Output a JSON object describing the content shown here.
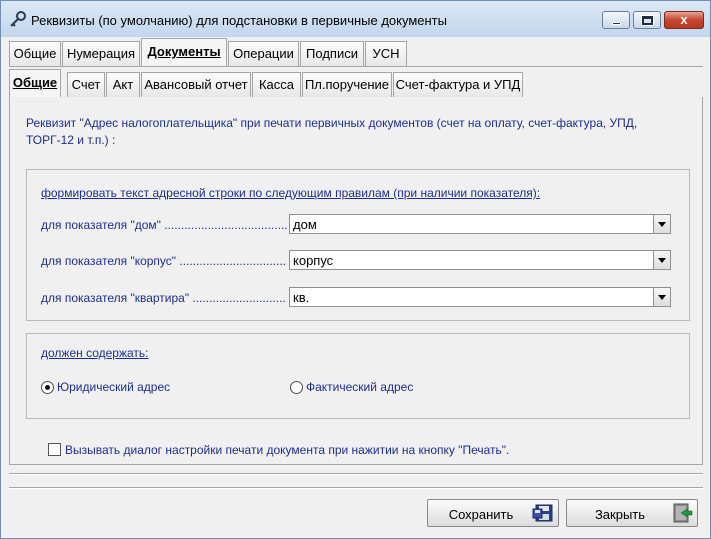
{
  "window": {
    "title": "Реквизиты (по умолчанию) для подстановки в первичные документы",
    "close_glyph": "x"
  },
  "tabs_main": [
    {
      "label": "Общие"
    },
    {
      "label": "Нумерация"
    },
    {
      "label": "Документы"
    },
    {
      "label": "Операции"
    },
    {
      "label": "Подписи"
    },
    {
      "label": "УСН"
    }
  ],
  "tabs_sub": [
    {
      "label": "Общие"
    },
    {
      "label": "Счет"
    },
    {
      "label": "Акт"
    },
    {
      "label": "Авансовый отчет"
    },
    {
      "label": "Касса"
    },
    {
      "label": "Пл.поручение"
    },
    {
      "label": "Счет-фактура и УПД"
    }
  ],
  "content": {
    "description": "Реквизит \"Адрес налогоплательщика\" при печати первичных документов (счет на оплату, счет-фактура, УПД, ТОРГ-12 и т.п.) :",
    "rules": {
      "title": "формировать текст адресной строки по следующим правилам (при наличии показателя):",
      "rows": [
        {
          "label": "для показателя \"дом\" ...................................................",
          "value": "дом"
        },
        {
          "label": "для показателя \"корпус\" ...................................................",
          "value": "корпус"
        },
        {
          "label": "для показателя \"квартира\" ...................................................",
          "value": "кв."
        }
      ]
    },
    "contains": {
      "title": "должен содержать:",
      "options": [
        {
          "label": "Юридический адрес",
          "selected": true
        },
        {
          "label": "Фактический адрес",
          "selected": false
        }
      ]
    },
    "print_dialog_checkbox": {
      "label": "Вызывать диалог настройки печати документа при нажитии на кнопку \"Печать\".",
      "checked": false
    }
  },
  "buttons": {
    "save_label": "Сохранить",
    "close_label": "Закрыть"
  },
  "icons": {
    "app": "key-icon",
    "save": "save-floppy-icon",
    "close": "exit-door-icon"
  },
  "colors": {
    "label_text": "#1c2e8c",
    "title_gradient_top": "#dbe8f6",
    "close_button": "#c8452f"
  }
}
